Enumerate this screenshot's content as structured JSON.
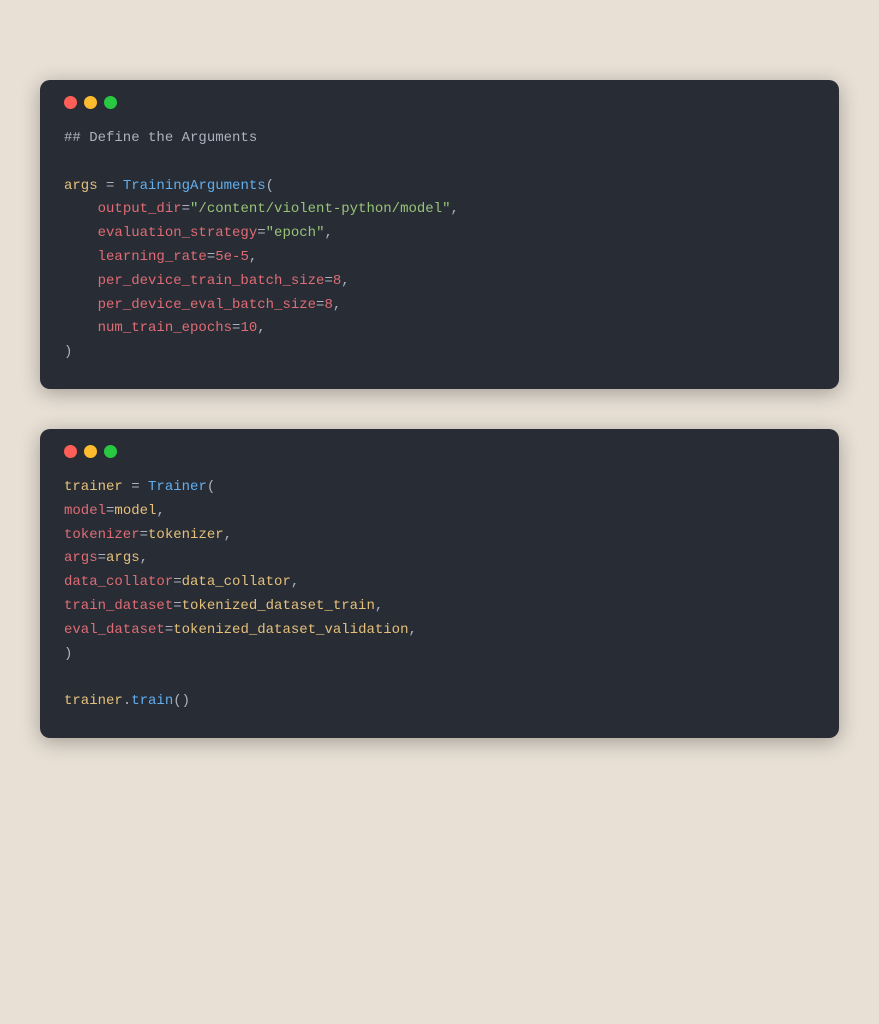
{
  "page": {
    "background": "#e8e0d5"
  },
  "block1": {
    "title": "code-block-1",
    "comment": "## Define the Arguments",
    "lines": [
      "args = TrainingArguments(",
      "    output_dir=\"/content/violent-python/model\",",
      "    evaluation_strategy=\"epoch\",",
      "    learning_rate=5e-5,",
      "    per_device_train_batch_size=8,",
      "    per_device_eval_batch_size=8,",
      "    num_train_epochs=10,",
      ")"
    ]
  },
  "block2": {
    "title": "code-block-2",
    "lines": [
      "trainer = Trainer(",
      "model=model,",
      "tokenizer=tokenizer,",
      "args=args,",
      "data_collator=data_collator,",
      "train_dataset=tokenized_dataset_train,",
      "eval_dataset=tokenized_dataset_validation,",
      ")",
      "",
      "trainer.train()"
    ]
  },
  "controls": {
    "red": "#ff5f57",
    "yellow": "#febc2e",
    "green": "#28c840"
  }
}
